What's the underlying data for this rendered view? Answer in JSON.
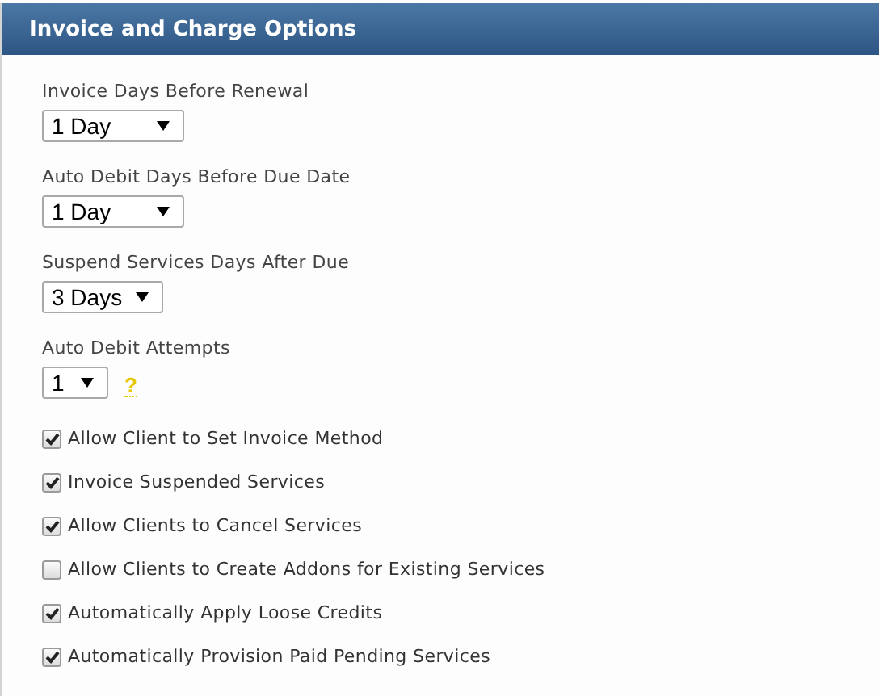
{
  "panel": {
    "title": "Invoice and Charge Options"
  },
  "selects": [
    {
      "label": "Invoice Days Before Renewal",
      "value": "1 Day"
    },
    {
      "label": "Auto Debit Days Before Due Date",
      "value": "1 Day"
    },
    {
      "label": "Suspend Services Days After Due",
      "value": "3 Days"
    },
    {
      "label": "Auto Debit Attempts",
      "value": "1",
      "help": "?"
    }
  ],
  "checkboxes": [
    {
      "label": "Allow Client to Set Invoice Method",
      "checked": true
    },
    {
      "label": "Invoice Suspended Services",
      "checked": true
    },
    {
      "label": "Allow Clients to Cancel Services",
      "checked": true
    },
    {
      "label": "Allow Clients to Create Addons for Existing Services",
      "checked": false
    },
    {
      "label": "Automatically Apply Loose Credits",
      "checked": true
    },
    {
      "label": "Automatically Provision Paid Pending Services",
      "checked": true
    }
  ]
}
